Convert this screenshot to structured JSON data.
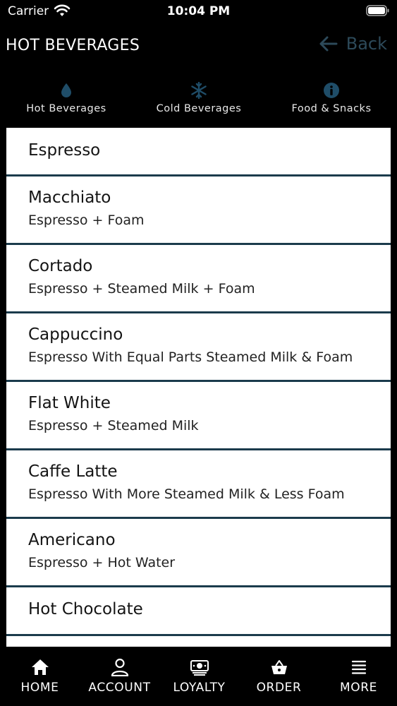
{
  "status_bar": {
    "carrier": "Carrier",
    "time": "10:04 PM"
  },
  "header": {
    "title": "HOT BEVERAGES",
    "back_label": "Back"
  },
  "colors": {
    "accent": "#2d4a5a",
    "icon_blue": "#1f4d68",
    "divider": "#1b3b4c"
  },
  "categories": [
    {
      "label": "Hot Beverages",
      "icon": "drop-icon"
    },
    {
      "label": "Cold Beverages",
      "icon": "snowflake-icon"
    },
    {
      "label": "Food & Snacks",
      "icon": "info-icon"
    }
  ],
  "menu_items": [
    {
      "name": "Espresso",
      "description": ""
    },
    {
      "name": "Macchiato",
      "description": "Espresso + Foam"
    },
    {
      "name": "Cortado",
      "description": "Espresso + Steamed Milk + Foam"
    },
    {
      "name": "Cappuccino",
      "description": "Espresso With Equal Parts Steamed Milk & Foam"
    },
    {
      "name": "Flat White",
      "description": "Espresso + Steamed Milk"
    },
    {
      "name": "Caffe Latte",
      "description": "Espresso With More Steamed Milk & Less Foam"
    },
    {
      "name": "Americano",
      "description": "Espresso + Hot Water"
    },
    {
      "name": "Hot Chocolate",
      "description": ""
    }
  ],
  "tabs": [
    {
      "label": "HOME",
      "icon": "home-icon"
    },
    {
      "label": "ACCOUNT",
      "icon": "person-icon"
    },
    {
      "label": "LOYALTY",
      "icon": "cash-icon"
    },
    {
      "label": "ORDER",
      "icon": "basket-icon"
    },
    {
      "label": "MORE",
      "icon": "menu-icon"
    }
  ]
}
